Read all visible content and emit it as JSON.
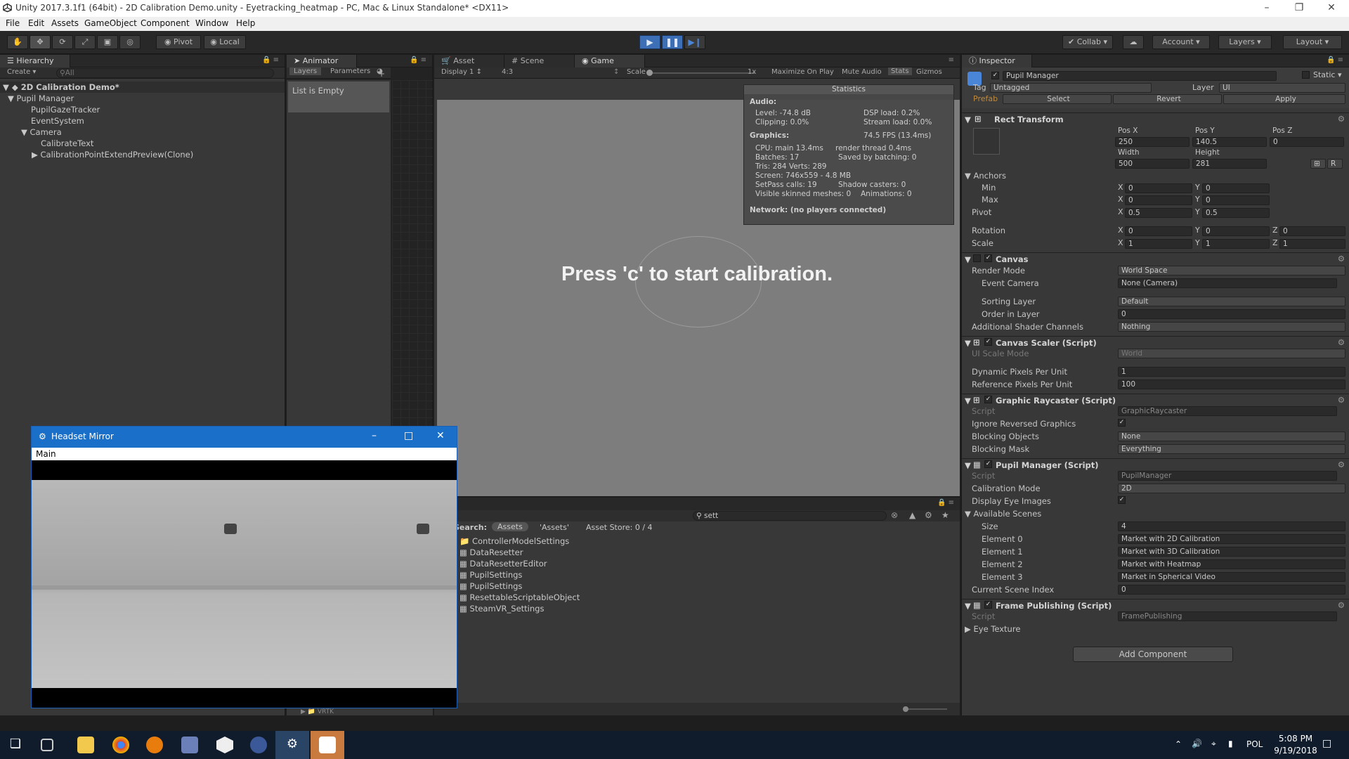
{
  "window": {
    "title": "Unity 2017.3.1f1 (64bit) - 2D Calibration Demo.unity - Eyetracking_heatmap - PC, Mac & Linux Standalone* <DX11>"
  },
  "menu": [
    "File",
    "Edit",
    "Assets",
    "GameObject",
    "Component",
    "Window",
    "Help"
  ],
  "toolbar": {
    "pivot": "Pivot",
    "local": "Local",
    "collab": "Collab",
    "account": "Account",
    "layers": "Layers",
    "layout": "Layout"
  },
  "hierarchy": {
    "tab": "Hierarchy",
    "create": "Create",
    "search_placeholder": "All",
    "scene": "2D Calibration Demo*",
    "items": [
      "Pupil Manager",
      "PupilGazeTracker",
      "EventSystem",
      "Camera",
      "CalibrateText",
      "CalibrationPointExtendPreview(Clone)"
    ]
  },
  "animator": {
    "tab": "Animator",
    "layers": "Layers",
    "parameters": "Parameters",
    "empty": "List is Empty"
  },
  "center_tabs": [
    "Asset Store",
    "Scene",
    "Game"
  ],
  "game": {
    "display": "Display 1",
    "aspect": "4:3",
    "scale_label": "Scale",
    "scale_value": "1x",
    "maximize": "Maximize On Play",
    "mute": "Mute Audio",
    "stats": "Stats",
    "gizmos": "Gizmos",
    "prompt": "Press 'c' to start calibration."
  },
  "statistics": {
    "title": "Statistics",
    "audio_h": "Audio:",
    "level": "Level: -74.8 dB",
    "dsp": "DSP load: 0.2%",
    "clipping": "Clipping: 0.0%",
    "stream": "Stream load: 0.0%",
    "graphics_h": "Graphics:",
    "fps": "74.5 FPS (13.4ms)",
    "cpu_main": "CPU: main 13.4ms",
    "render_thread": "render thread 0.4ms",
    "batches": "Batches: 17",
    "saved": "Saved by batching: 0",
    "tris": "Tris: 284   Verts: 289",
    "screen": "Screen: 746x559 - 4.8 MB",
    "setpass": "SetPass calls: 19",
    "shadow": "Shadow casters: 0",
    "skinned": "Visible skinned meshes: 0",
    "animations": "Animations: 0",
    "network": "Network: (no players connected)"
  },
  "project": {
    "search_value": "sett",
    "search_label": "Search:",
    "scope_assets": "Assets",
    "scope_quoted": "'Assets'",
    "asset_store": "Asset Store: 0 / 4",
    "items": [
      "ControllerModelSettings",
      "DataResetter",
      "DataResetterEditor",
      "PupilSettings",
      "PupilSettings",
      "ResettableScriptableObject",
      "SteamVR_Settings"
    ],
    "partial": "VRTK"
  },
  "mirror": {
    "title": "Headset Mirror",
    "menu": "Main"
  },
  "inspector": {
    "tab": "Inspector",
    "object_name": "Pupil Manager",
    "static": "Static",
    "tag_label": "Tag",
    "tag": "Untagged",
    "layer_label": "Layer",
    "layer": "UI",
    "prefab": "Prefab",
    "select": "Select",
    "revert": "Revert",
    "apply": "Apply",
    "rect": {
      "title": "Rect Transform",
      "posx_l": "Pos X",
      "posy_l": "Pos Y",
      "posz_l": "Pos Z",
      "posx": "250",
      "posy": "140.5",
      "posz": "0",
      "width_l": "Width",
      "height_l": "Height",
      "width": "500",
      "height": "281",
      "anchors": "Anchors",
      "min_l": "Min",
      "max_l": "Max",
      "pivot_l": "Pivot",
      "min_x": "0",
      "min_y": "0",
      "max_x": "0",
      "max_y": "0",
      "pivot_x": "0.5",
      "pivot_y": "0.5",
      "rotation_l": "Rotation",
      "scale_l": "Scale",
      "rot_x": "0",
      "rot_y": "0",
      "rot_z": "0",
      "sc_x": "1",
      "sc_y": "1",
      "sc_z": "1",
      "x": "X",
      "y": "Y",
      "z": "Z",
      "r": "R"
    },
    "canvas": {
      "title": "Canvas",
      "render_mode_l": "Render Mode",
      "render_mode": "World Space",
      "event_camera_l": "Event Camera",
      "event_camera": "None (Camera)",
      "sorting_layer_l": "Sorting Layer",
      "sorting_layer": "Default",
      "order_l": "Order in Layer",
      "order": "0",
      "shader_l": "Additional Shader Channels",
      "shader": "Nothing"
    },
    "scaler": {
      "title": "Canvas Scaler (Script)",
      "ui_scale_l": "UI Scale Mode",
      "ui_scale": "World",
      "dpu_l": "Dynamic Pixels Per Unit",
      "dpu": "1",
      "rpu_l": "Reference Pixels Per Unit",
      "rpu": "100"
    },
    "raycaster": {
      "title": "Graphic Raycaster (Script)",
      "script_l": "Script",
      "script": "GraphicRaycaster",
      "ignore_l": "Ignore Reversed Graphics",
      "blocking_l": "Blocking Objects",
      "blocking": "None",
      "mask_l": "Blocking Mask",
      "mask": "Everything"
    },
    "pupil": {
      "title": "Pupil Manager (Script)",
      "script_l": "Script",
      "script": "PupilManager",
      "mode_l": "Calibration Mode",
      "mode": "2D",
      "eye_l": "Display Eye Images",
      "scenes_l": "Available Scenes",
      "size_l": "Size",
      "size": "4",
      "elements": [
        {
          "label": "Element 0",
          "value": "Market with 2D Calibration"
        },
        {
          "label": "Element 1",
          "value": "Market with 3D Calibration"
        },
        {
          "label": "Element 2",
          "value": "Market with Heatmap"
        },
        {
          "label": "Element 3",
          "value": "Market in Spherical Video"
        }
      ],
      "index_l": "Current Scene Index",
      "index": "0"
    },
    "frame": {
      "title": "Frame Publishing (Script)",
      "script_l": "Script",
      "script": "FramePublishing",
      "eye_texture": "Eye Texture"
    },
    "add_component": "Add Component"
  },
  "taskbar": {
    "lang": "POL",
    "time": "5:08 PM",
    "date": "9/19/2018"
  },
  "colors": {
    "accent": "#3d6fb6",
    "panel": "#383838",
    "game_bg": "#7d7d7d",
    "taskbar": "#101c2c"
  }
}
